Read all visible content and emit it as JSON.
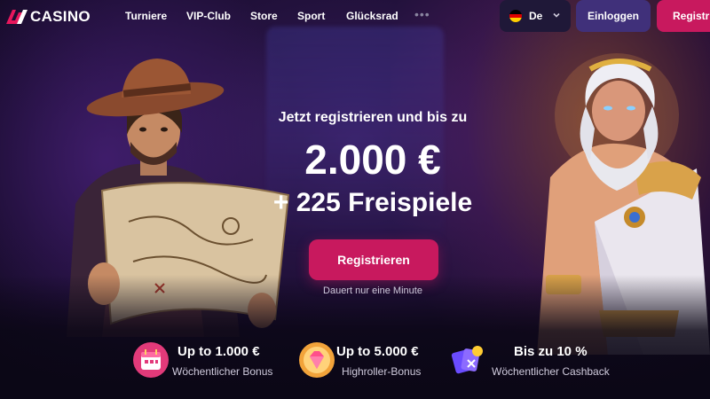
{
  "brand": {
    "logo_text": "CASINO"
  },
  "nav": {
    "items": [
      {
        "label": "Turniere"
      },
      {
        "label": "VIP-Club"
      },
      {
        "label": "Store"
      },
      {
        "label": "Sport"
      },
      {
        "label": "Glücksrad"
      }
    ],
    "more": "•••"
  },
  "language": {
    "current": "De"
  },
  "auth": {
    "login_label": "Einloggen",
    "register_label": "Registrieren"
  },
  "hero": {
    "subtitle": "Jetzt registrieren und bis zu",
    "amount": "2.000 €",
    "spins": "+ 225 Freispiele",
    "cta_label": "Registrieren",
    "note": "Dauert nur eine Minute"
  },
  "benefits": [
    {
      "title": "Up to 1.000 €",
      "subtitle": "Wöchentlicher Bonus",
      "icon": "calendar-gift-icon"
    },
    {
      "title": "Up to 5.000 €",
      "subtitle": "Highroller-Bonus",
      "icon": "diamond-icon"
    },
    {
      "title": "Bis zu 10 %",
      "subtitle": "Wöchentlicher Cashback",
      "icon": "cashback-cards-icon"
    }
  ],
  "colors": {
    "accent": "#c8195e",
    "secondary_button": "#40307a",
    "background": "#140a26"
  }
}
